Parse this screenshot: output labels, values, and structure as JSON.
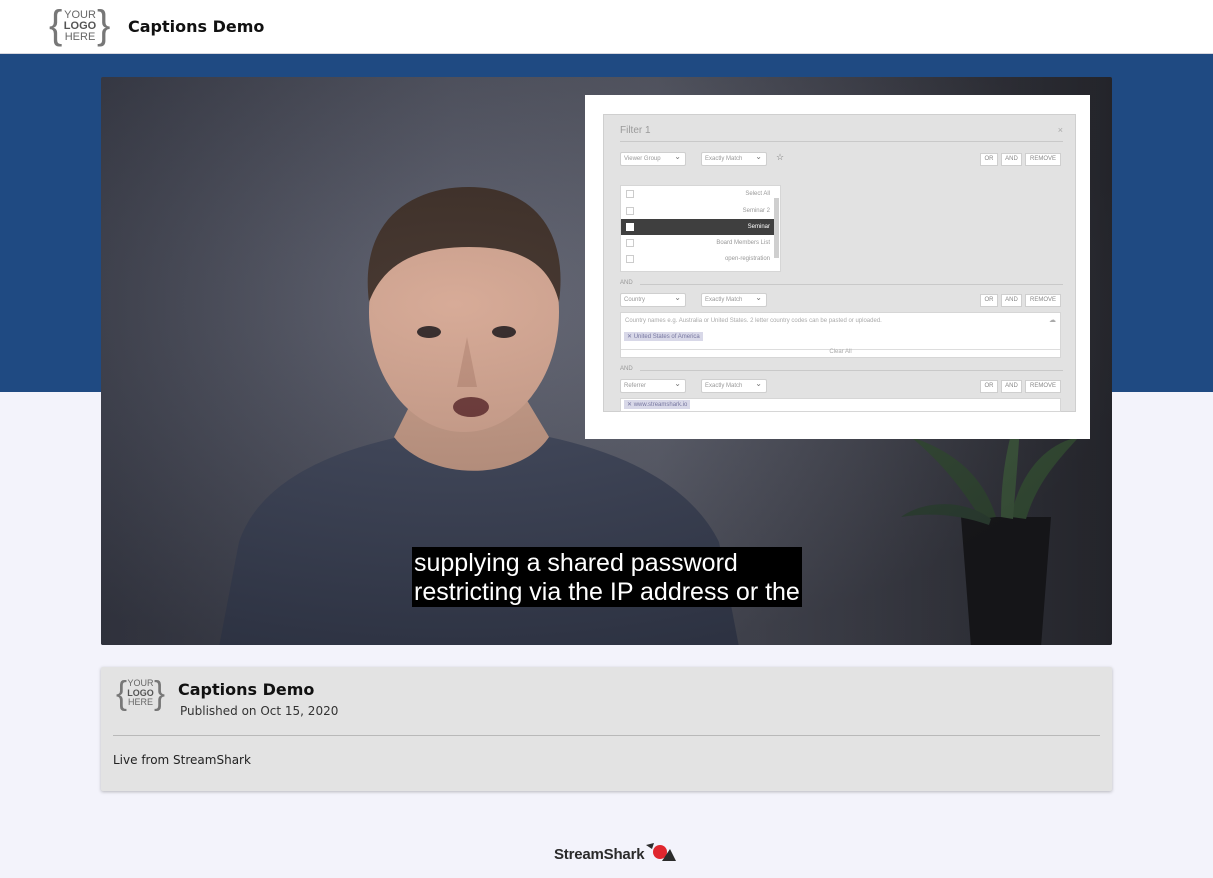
{
  "header": {
    "logo": {
      "line1": "YOUR",
      "line2": "LOGO",
      "line3": "HERE"
    },
    "title": "Captions Demo"
  },
  "video": {
    "captions": [
      "supplying a shared password",
      "restricting via the IP address or the"
    ],
    "inset": {
      "filter_title": "Filter 1",
      "close": "×",
      "row1": {
        "field": "Viewer Group",
        "match": "Exactly Match"
      },
      "buttons": {
        "or": "OR",
        "and": "AND",
        "remove": "REMOVE"
      },
      "list": [
        {
          "label": "Select All",
          "checked": false
        },
        {
          "label": "Seminar 2",
          "checked": false
        },
        {
          "label": "Seminar",
          "checked": true
        },
        {
          "label": "Board Members List",
          "checked": false
        },
        {
          "label": "open-registration",
          "checked": false
        }
      ],
      "and_label": "AND",
      "row2": {
        "field": "Country",
        "match": "Exactly Match"
      },
      "country_hint": "Country names e.g. Australia or United States. 2 letter country codes can be pasted or uploaded.",
      "country_chip": "United States of America",
      "clear_all": "Clear All",
      "row3": {
        "field": "Referrer",
        "match": "Exactly Match"
      },
      "referrer_chip": "www.streamshark.io"
    }
  },
  "card": {
    "logo": {
      "line1": "YOUR",
      "line2": "LOGO",
      "line3": "HERE"
    },
    "title": "Captions Demo",
    "published": "Published on Oct 15, 2020",
    "description": "Live from StreamShark"
  },
  "footer": {
    "brand": "StreamShark"
  },
  "colors": {
    "header_band": "#1f4a82",
    "page_bg": "#f3f3fb",
    "brand_red": "#e0262e"
  }
}
